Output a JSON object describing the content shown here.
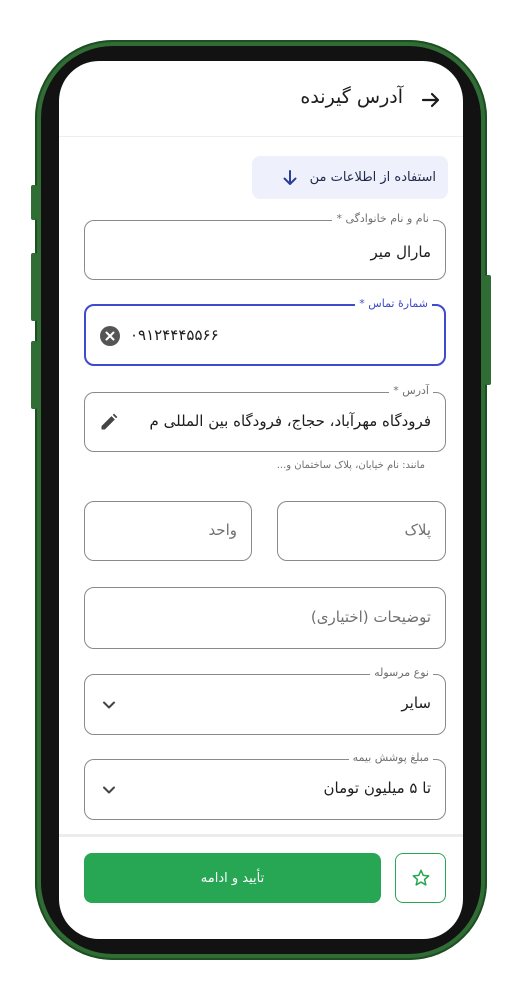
{
  "header": {
    "title": "آدرس گیرنده"
  },
  "use_my_info": {
    "label": "استفاده از اطلاعات من"
  },
  "name_field": {
    "label": "نام و نام خانوادگی *",
    "value": "مارال میر"
  },
  "phone_field": {
    "label": "شمارهٔ تماس *",
    "value": "۰۹۱۲۴۴۴۵۵۶۶"
  },
  "address_field": {
    "label": "آدرس *",
    "value": "فرودگاه مهرآباد، حجاج، فرودگاه بین المللی م",
    "helper": "مانند: نام خیابان، پلاک ساختمان و..."
  },
  "plaque_field": {
    "placeholder": "پلاک"
  },
  "unit_field": {
    "placeholder": "واحد"
  },
  "notes_field": {
    "placeholder": "توضیحات (اختیاری)"
  },
  "parcel_type": {
    "label": "نوع مرسوله",
    "value": "سایر"
  },
  "insurance": {
    "label": "مبلغ پوشش بیمه",
    "value": "تا ۵ میلیون تومان"
  },
  "footer": {
    "confirm_label": "تأیید و ادامه"
  },
  "colors": {
    "primary_green": "#27a653",
    "focus_blue": "#3d4bcc",
    "frame_green": "#2f6d35"
  }
}
